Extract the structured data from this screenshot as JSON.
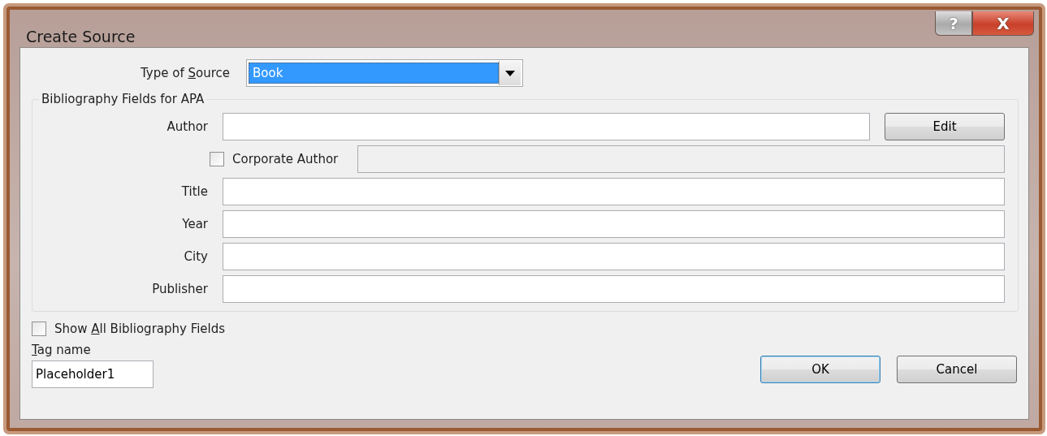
{
  "window": {
    "title": "Create Source",
    "buttons": [
      {
        "kind": "help",
        "label": "?"
      },
      {
        "kind": "close",
        "label": "X"
      }
    ]
  },
  "type_of_source": {
    "label": {
      "before": "Type of ",
      "access_key": "S",
      "after": "ource"
    },
    "value": "Book",
    "selected": true
  },
  "group": {
    "legend": "Bibliography Fields for APA",
    "fields": [
      {
        "kind": "text",
        "label": "Author",
        "button": "Edit"
      },
      {
        "kind": "checkbox",
        "label": "Corporate Author",
        "checked": false,
        "disabled": true
      },
      {
        "kind": "text",
        "label": "Title"
      },
      {
        "kind": "text",
        "label": "Year"
      },
      {
        "kind": "text",
        "label": "City"
      },
      {
        "kind": "text",
        "label": "Publisher"
      }
    ]
  },
  "show_all": {
    "label": {
      "before": "Show ",
      "access_key": "A",
      "after": "ll Bibliography Fields"
    },
    "checked": false
  },
  "tag_name": {
    "label": {
      "access_key": "T",
      "after": "ag name"
    },
    "value": "Placeholder1"
  },
  "buttons": [
    {
      "label": "OK",
      "default": true
    },
    {
      "label": "Cancel",
      "default": false
    }
  ]
}
